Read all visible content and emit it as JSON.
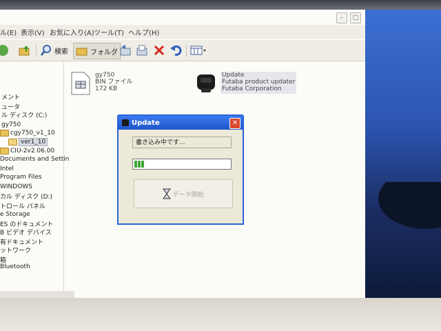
{
  "menubar": {
    "items": [
      "ル(E)",
      "表示(V)",
      "お気に入り(A)",
      "ツール(T)",
      "ヘルプ(H)"
    ]
  },
  "toolbar": {
    "search_label": "検索",
    "folders_label": "フォルダ"
  },
  "tree": {
    "items": [
      "メント",
      "ュータ",
      "ル ディスク (C:)",
      "gy750",
      "cgy750_v1_10",
      "ver1_10",
      "CIU-2v2.06.00",
      "Documents and Settin",
      "Intel",
      "Program Files",
      "WINDOWS",
      "カル ディスク (D:)",
      "トロール パネル",
      "e Storage",
      "ES のドキュメント",
      "B ビデオ デバイス",
      "有ドキュメント",
      "ットワーク",
      "箱",
      "Bluetooth"
    ]
  },
  "files": [
    {
      "name": "gy750",
      "type": "BIN ファイル",
      "size": "172 KB"
    },
    {
      "name": "Update",
      "type": "Futaba product updater",
      "company": "Futaba Corporation"
    }
  ],
  "dialog": {
    "title": "Update",
    "status": "書き込み中です...",
    "progress": 0.1,
    "start_button": "データ開始"
  },
  "colors": {
    "titlebar": "#2a62d9",
    "progress": "#3fa43a",
    "close": "#d9472d"
  }
}
